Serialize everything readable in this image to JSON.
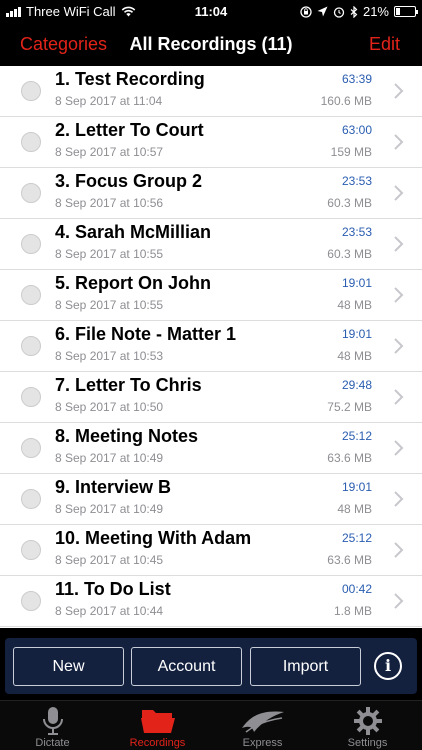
{
  "status_bar": {
    "carrier": "Three WiFi Call",
    "time": "11:04",
    "battery_text": "21%",
    "battery_level": 0.21
  },
  "nav": {
    "left_label": "Categories",
    "title": "All Recordings (11)",
    "right_label": "Edit"
  },
  "recordings": [
    {
      "title": "1. Test Recording",
      "date": "8 Sep 2017 at 11:04",
      "duration": "63:39",
      "size": "160.6 MB"
    },
    {
      "title": "2. Letter To Court",
      "date": "8 Sep 2017 at 10:57",
      "duration": "63:00",
      "size": "159 MB"
    },
    {
      "title": "3. Focus Group 2",
      "date": "8 Sep 2017 at 10:56",
      "duration": "23:53",
      "size": "60.3 MB"
    },
    {
      "title": "4. Sarah McMillian",
      "date": "8 Sep 2017 at 10:55",
      "duration": "23:53",
      "size": "60.3 MB"
    },
    {
      "title": "5. Report On John",
      "date": "8 Sep 2017 at 10:55",
      "duration": "19:01",
      "size": "48 MB"
    },
    {
      "title": "6. File Note - Matter 1",
      "date": "8 Sep 2017 at 10:53",
      "duration": "19:01",
      "size": "48 MB"
    },
    {
      "title": "7. Letter To Chris",
      "date": "8 Sep 2017 at 10:50",
      "duration": "29:48",
      "size": "75.2 MB"
    },
    {
      "title": "8. Meeting Notes",
      "date": "8 Sep 2017 at 10:49",
      "duration": "25:12",
      "size": "63.6 MB"
    },
    {
      "title": "9. Interview B",
      "date": "8 Sep 2017 at 10:49",
      "duration": "19:01",
      "size": "48 MB"
    },
    {
      "title": "10. Meeting With Adam",
      "date": "8 Sep 2017 at 10:45",
      "duration": "25:12",
      "size": "63.6 MB"
    },
    {
      "title": "11. To Do List",
      "date": "8 Sep 2017 at 10:44",
      "duration": "00:42",
      "size": "1.8 MB"
    }
  ],
  "actions": {
    "new_label": "New",
    "account_label": "Account",
    "import_label": "Import",
    "info_label": "i"
  },
  "tabs": [
    {
      "label": "Dictate",
      "icon": "microphone-icon",
      "active": false
    },
    {
      "label": "Recordings",
      "icon": "folder-icon",
      "active": true
    },
    {
      "label": "Express",
      "icon": "express-wave-icon",
      "active": false
    },
    {
      "label": "Settings",
      "icon": "gear-icon",
      "active": false
    }
  ],
  "colors": {
    "accent": "#e2231a",
    "duration": "#2a5db0",
    "action_bar": "#13213f"
  }
}
